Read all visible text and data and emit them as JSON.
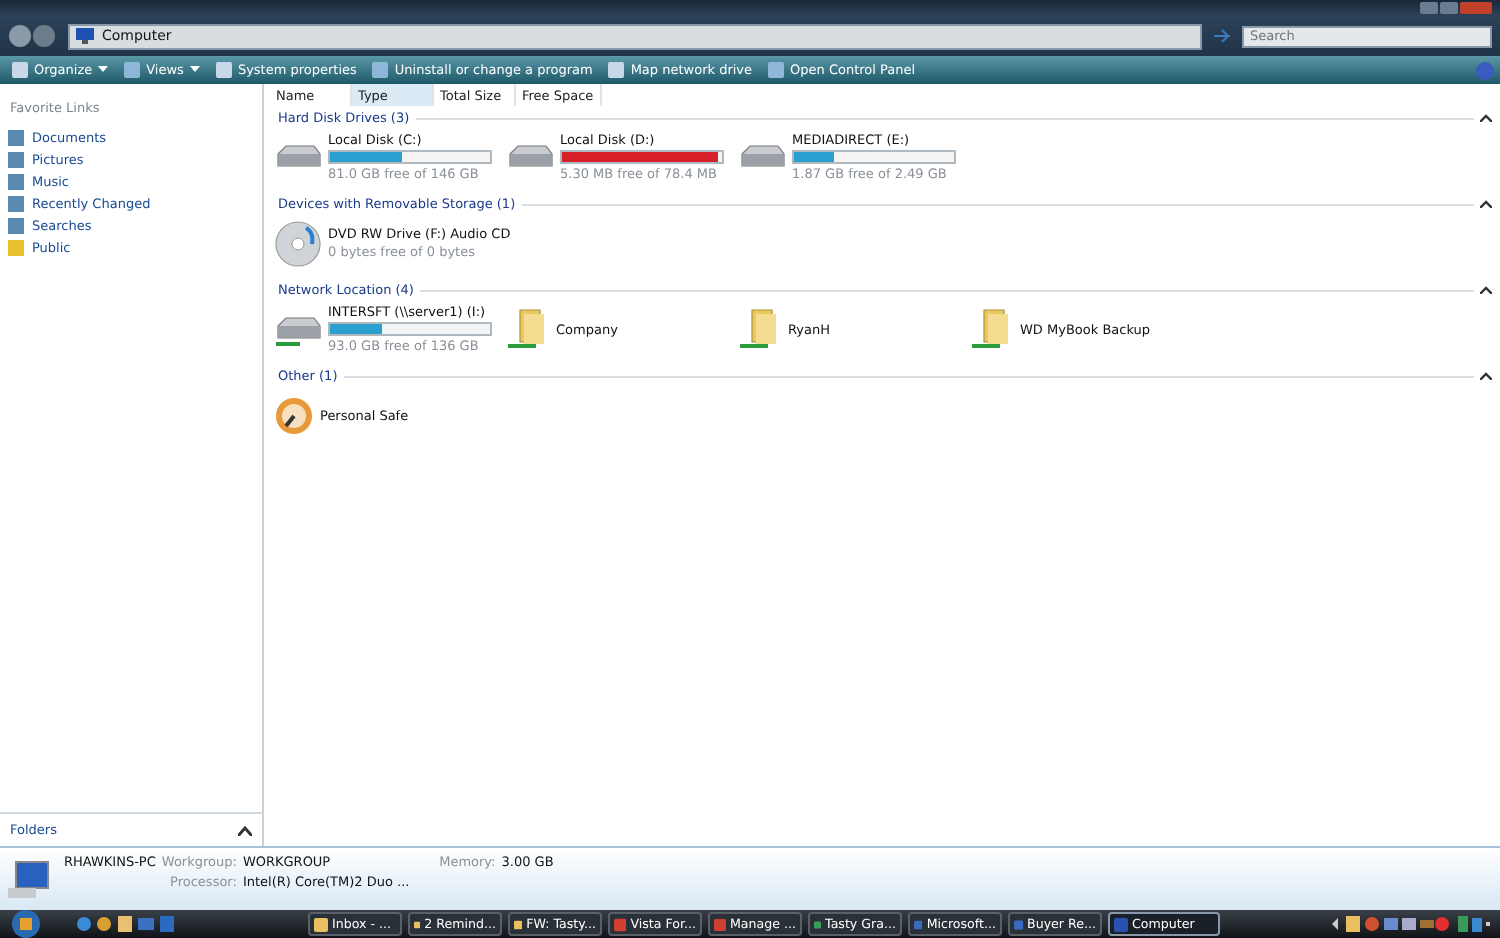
{
  "address_bar": {
    "path": "Computer",
    "search_placeholder": "Search"
  },
  "toolbar": [
    {
      "label": "Organize",
      "dropdown": true
    },
    {
      "label": "Views",
      "dropdown": true
    },
    {
      "label": "System properties",
      "dropdown": false
    },
    {
      "label": "Uninstall or change a program",
      "dropdown": false
    },
    {
      "label": "Map network drive",
      "dropdown": false
    },
    {
      "label": "Open Control Panel",
      "dropdown": false
    }
  ],
  "sidebar": {
    "title": "Favorite Links",
    "items": [
      {
        "label": "Documents"
      },
      {
        "label": "Pictures"
      },
      {
        "label": "Music"
      },
      {
        "label": "Recently Changed"
      },
      {
        "label": "Searches"
      },
      {
        "label": "Public"
      }
    ],
    "folders_label": "Folders"
  },
  "columns": [
    {
      "label": "Name",
      "selected": false
    },
    {
      "label": "Type",
      "selected": true
    },
    {
      "label": "Total Size",
      "selected": false
    },
    {
      "label": "Free Space",
      "selected": false
    }
  ],
  "groups": [
    {
      "title": "Hard Disk Drives (3)",
      "items": [
        {
          "kind": "drive",
          "name": "Local Disk (C:)",
          "level": 0.45,
          "color": "#2a9fd0",
          "free": "81.0 GB free of 146 GB"
        },
        {
          "kind": "drive",
          "name": "Local Disk (D:)",
          "level": 0.97,
          "color": "#d8202a",
          "free": "5.30 MB free of 78.4 MB"
        },
        {
          "kind": "drive",
          "name": "MEDIADIRECT (E:)",
          "level": 0.25,
          "color": "#2a9fd0",
          "free": "1.87 GB free of 2.49 GB"
        }
      ]
    },
    {
      "title": "Devices with Removable Storage (1)",
      "items": [
        {
          "kind": "dvd",
          "name": "DVD RW Drive (F:) Audio CD",
          "free": "0 bytes free of 0 bytes"
        }
      ]
    },
    {
      "title": "Network Location (4)",
      "items": [
        {
          "kind": "network_drive",
          "name": "INTERSFT (\\\\server1) (I:)",
          "level": 0.32,
          "color": "#2a9fd0",
          "free": "93.0 GB free of 136 GB"
        },
        {
          "kind": "network_folder",
          "name": "Company"
        },
        {
          "kind": "network_folder",
          "name": "RyanH"
        },
        {
          "kind": "network_folder",
          "name": "WD MyBook Backup"
        }
      ]
    },
    {
      "title": "Other (1)",
      "items": [
        {
          "kind": "safe",
          "name": "Personal Safe"
        }
      ]
    }
  ],
  "details": {
    "computer_name": "RHAWKINS-PC",
    "workgroup_label": "Workgroup:",
    "workgroup": "WORKGROUP",
    "memory_label": "Memory:",
    "memory": "3.00 GB",
    "processor_label": "Processor:",
    "processor": "Intel(R) Core(TM)2 Duo ..."
  },
  "taskbar": [
    {
      "label": "Inbox - ...",
      "selected": false
    },
    {
      "label": "2 Remind...",
      "selected": false
    },
    {
      "label": "FW: Tasty...",
      "selected": false
    },
    {
      "label": "Vista For...",
      "selected": false
    },
    {
      "label": "Manage ...",
      "selected": false
    },
    {
      "label": "Tasty Gra...",
      "selected": false
    },
    {
      "label": "Microsoft...",
      "selected": false
    },
    {
      "label": "Buyer Re...",
      "selected": false
    },
    {
      "label": "Computer",
      "selected": true
    }
  ]
}
